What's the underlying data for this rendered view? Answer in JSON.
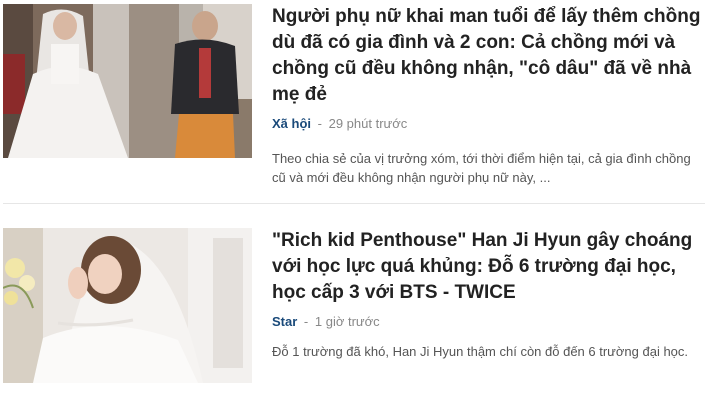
{
  "articles": [
    {
      "title": "Người phụ nữ khai man tuổi để lấy thêm chồng dù đã có gia đình và 2 con: Cả chồng mới và chồng cũ đều không nhận, \"cô dâu\" đã về nhà mẹ đẻ",
      "category": "Xã hội",
      "separator": "-",
      "time": "29 phút trước",
      "summary": "Theo chia sẻ của vị trưởng xóm, tới thời điểm hiện tại, cả gia đình chồng cũ và mới đều không nhận người phụ nữ này, ..."
    },
    {
      "title": "\"Rich kid Penthouse\" Han Ji Hyun gây choáng với học lực quá khủng: Đỗ 6 trường đại học, học cấp 3 với BTS - TWICE",
      "category": "Star",
      "separator": "-",
      "time": "1 giờ trước",
      "summary": "Đỗ 1 trường đã khó, Han Ji Hyun thậm chí còn đỗ đến 6 trường đại học."
    }
  ],
  "colors": {
    "title": "#222222",
    "category": "#1a4a7a",
    "meta": "#888888",
    "summary": "#555555",
    "divider": "#e6e6e6"
  }
}
